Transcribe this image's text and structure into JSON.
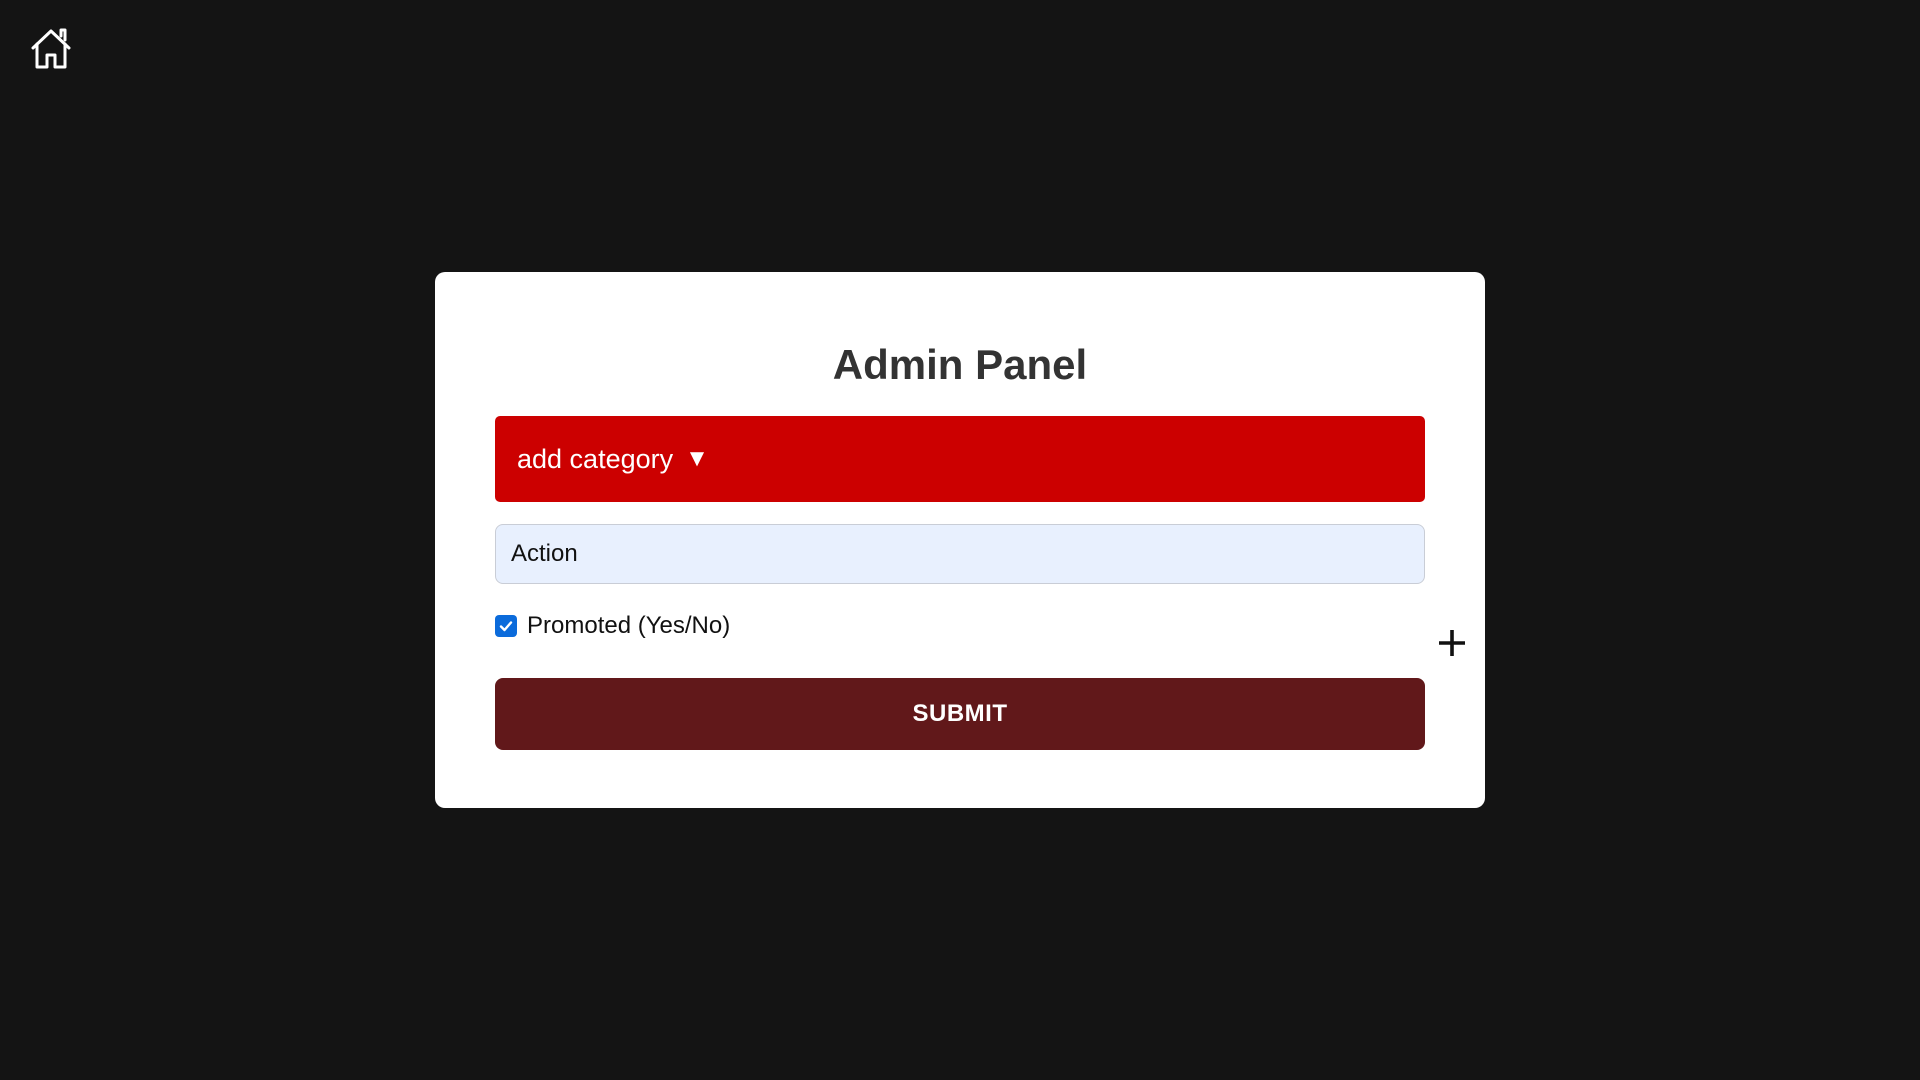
{
  "nav": {
    "home_icon": "home-icon"
  },
  "panel": {
    "title": "Admin Panel",
    "category_toggle": {
      "label": "add category",
      "arrow": "▼"
    },
    "category_input": {
      "value": "Action"
    },
    "promoted": {
      "label": "Promoted (Yes/No)",
      "checked": true
    },
    "add_icon": "plus-icon",
    "submit_label": "SUBMIT"
  },
  "colors": {
    "background": "#141414",
    "panel": "#ffffff",
    "category_toggle": "#cc0000",
    "input_bg": "#e8f0fe",
    "checkbox": "#0b6bdb",
    "submit": "#61181a"
  }
}
